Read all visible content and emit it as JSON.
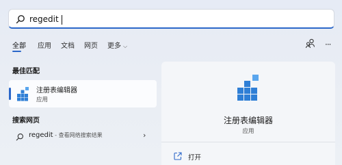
{
  "search": {
    "value": "regedit"
  },
  "tabs": [
    {
      "label": "全部"
    },
    {
      "label": "应用"
    },
    {
      "label": "文档"
    },
    {
      "label": "网页"
    },
    {
      "label": "更多"
    }
  ],
  "best_match": {
    "section_title": "最佳匹配",
    "name": "注册表编辑器",
    "type": "应用"
  },
  "web": {
    "section_title": "搜索网页",
    "query": "regedit",
    "hint": " - 查看网络搜索结果"
  },
  "detail": {
    "title": "注册表编辑器",
    "subtitle": "应用",
    "actions": [
      {
        "label": "打开"
      }
    ]
  },
  "icons": {
    "search": "search-icon",
    "app": "registry-editor-icon",
    "open": "open-external-icon",
    "account": "account-share-icon",
    "more": "more-icon"
  },
  "colors": {
    "accent": "#2b67c9",
    "icon_blue": "#2f7fd6"
  }
}
